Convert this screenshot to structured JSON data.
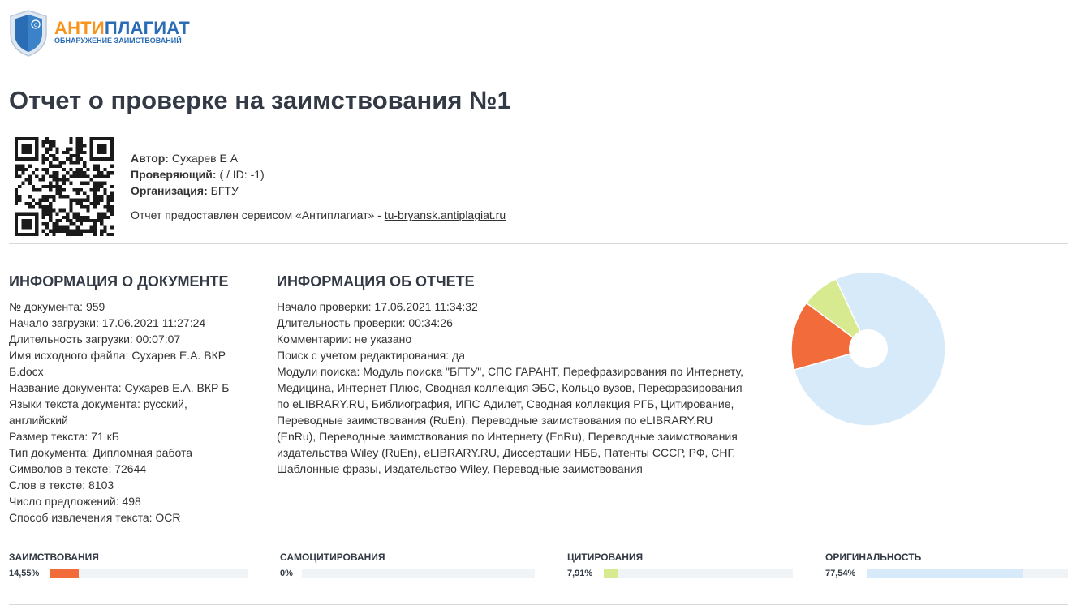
{
  "logo": {
    "part1": "АНТИ",
    "part2": "ПЛАГИАТ",
    "subtitle": "ОБНАРУЖЕНИЕ ЗАИМСТВОВАНИЙ"
  },
  "title": "Отчет о проверке на заимствования №1",
  "author": {
    "label": "Автор:",
    "value": "Сухарев Е А"
  },
  "reviewer": {
    "label": "Проверяющий:",
    "value": "( / ID: -1)"
  },
  "organization": {
    "label": "Организация:",
    "value": "БГТУ"
  },
  "service": {
    "text": "Отчет предоставлен сервисом «Антиплагиат» - ",
    "link": "tu-bryansk.antiplagiat.ru"
  },
  "doc_info": {
    "heading": "ИНФОРМАЦИЯ О ДОКУМЕНТЕ",
    "lines": [
      "№ документа: 959",
      "Начало загрузки: 17.06.2021 11:27:24",
      "Длительность загрузки: 00:07:07",
      "Имя исходного файла: Сухарев Е.А. ВКР Б.docx",
      "Название документа: Сухарев Е.А. ВКР Б",
      "Языки текста документа: русский, английский",
      "Размер текста: 71 кБ",
      "Тип документа: Дипломная работа",
      "Символов в тексте: 72644",
      "Слов в тексте: 8103",
      "Число предложений: 498",
      "Способ извлечения текста: OCR"
    ]
  },
  "report_info": {
    "heading": "ИНФОРМАЦИЯ ОБ ОТЧЕТЕ",
    "lines": [
      "Начало проверки: 17.06.2021 11:34:32",
      "Длительность проверки: 00:34:26",
      "Комментарии: не указано",
      "Поиск с учетом редактирования: да",
      "Модули поиска: Модуль поиска \"БГТУ\", СПС ГАРАНТ, Перефразирования по Интернету, Медицина, Интернет Плюс, Сводная коллекция ЭБС, Кольцо вузов, Перефразирования по eLIBRARY.RU, Библиография, ИПС Адилет, Сводная коллекция РГБ, Цитирование, Переводные заимствования (RuEn), Переводные заимствования по eLIBRARY.RU (EnRu), Переводные заимствования по Интернету (EnRu), Переводные заимствования издательства Wiley (RuEn), eLIBRARY.RU, Диссертации НББ, Патенты СССР, РФ, СНГ, Шаблонные фразы, Издательство Wiley, Переводные заимствования"
    ]
  },
  "stats": [
    {
      "label": "ЗАИМСТВОВАНИЯ",
      "value": "14,55%",
      "fraction": 0.1455,
      "color": "#f26b3a"
    },
    {
      "label": "САМОЦИТИРОВАНИЯ",
      "value": "0%",
      "fraction": 0.0,
      "color": "#9ec3e6"
    },
    {
      "label": "ЦИТИРОВАНИЯ",
      "value": "7,91%",
      "fraction": 0.0791,
      "color": "#d7ea8f"
    },
    {
      "label": "ОРИГИНАЛЬНОСТЬ",
      "value": "77,54%",
      "fraction": 0.7754,
      "color": "#d6eaf9"
    }
  ],
  "chart_data": {
    "type": "pie",
    "categories": [
      "Заимствования",
      "Самоцитирования",
      "Цитирования",
      "Оригинальность"
    ],
    "values": [
      14.55,
      0,
      7.91,
      77.54
    ],
    "colors": [
      "#f26b3a",
      "#9ec3e6",
      "#d7ea8f",
      "#d6eaf9"
    ],
    "title": "",
    "donut": true
  }
}
